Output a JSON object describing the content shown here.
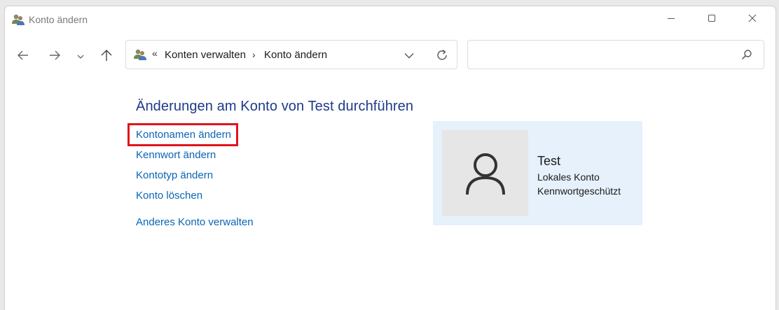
{
  "window": {
    "title": "Konto ändern"
  },
  "icons": {
    "app": "users-icon",
    "minimize": "minimize-icon",
    "maximize": "maximize-icon",
    "close": "close-icon",
    "back": "arrow-left-icon",
    "forward": "arrow-right-icon",
    "recent": "chevron-down-icon",
    "up": "arrow-up-icon",
    "dropdown": "chevron-down-icon",
    "refresh": "refresh-icon",
    "search": "search-icon",
    "avatar": "user-icon"
  },
  "addressbar": {
    "overflow": "«",
    "crumbs": [
      "Konten verwalten",
      "Konto ändern"
    ],
    "separator": "›"
  },
  "search": {
    "value": "",
    "placeholder": ""
  },
  "content": {
    "heading": "Änderungen am Konto von Test durchführen",
    "links": [
      "Kontonamen ändern",
      "Kennwort ändern",
      "Kontotyp ändern",
      "Konto löschen",
      "Anderes Konto verwalten"
    ],
    "highlighted_link_index": 0
  },
  "account": {
    "name": "Test",
    "type": "Lokales Konto",
    "protection": "Kennwortgeschützt"
  },
  "colors": {
    "heading": "#1e3a8a",
    "link": "#0a64b4",
    "highlight_border": "#e0141e",
    "card_background": "#e6f1fc",
    "avatar_background": "#e6e6e6"
  }
}
